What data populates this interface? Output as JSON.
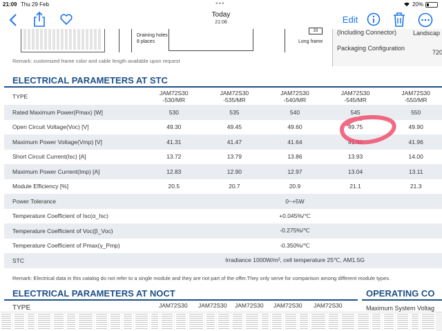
{
  "status_bar": {
    "time": "21:09",
    "date": "Thu 29 Feb",
    "battery": "20%"
  },
  "toolbar": {
    "title": "Today",
    "subtitle": "21:08",
    "edit_label": "Edit"
  },
  "drawing": {
    "drain_label_1": "Draining holes",
    "drain_label_2": "8 places",
    "dim_33": "33",
    "long_frame": "Long frame",
    "including_connector": "(Including Connector)",
    "landscape": "Landscap",
    "packaging": "Packaging Configuration",
    "packaging_value": "720"
  },
  "remark_frame": "Remark: customized frame color and cable length available upon request",
  "stc": {
    "title": "ELECTRICAL PARAMETERS AT STC",
    "type_label": "TYPE",
    "models": [
      [
        "JAM72S30",
        "-530/MR"
      ],
      [
        "JAM72S30",
        "-535/MR"
      ],
      [
        "JAM72S30",
        "-540/MR"
      ],
      [
        "JAM72S30",
        "-545/MR"
      ],
      [
        "JAM72S30",
        "-550/MR"
      ]
    ],
    "rows": [
      {
        "label": "Rated Maximum Power(Pmax) [W]",
        "values": [
          "530",
          "535",
          "540",
          "545",
          "550"
        ]
      },
      {
        "label": "Open Circuit Voltage(Voc) [V]",
        "values": [
          "49.30",
          "49.45",
          "49.60",
          "49.75",
          "49.90"
        ]
      },
      {
        "label": "Maximum Power Voltage(Vmp) [V]",
        "values": [
          "41.31",
          "41.47",
          "41.64",
          "41.80",
          "41.96"
        ]
      },
      {
        "label": "Short Circuit Current(Isc) [A]",
        "values": [
          "13.72",
          "13.79",
          "13.86",
          "13.93",
          "14.00"
        ]
      },
      {
        "label": "Maximum Power Current(Imp) [A]",
        "values": [
          "12.83",
          "12.90",
          "12.97",
          "13.04",
          "13.11"
        ]
      },
      {
        "label": "Module Efficiency [%]",
        "values": [
          "20.5",
          "20.7",
          "20.9",
          "21.1",
          "21.3"
        ]
      }
    ],
    "merged_rows": [
      {
        "label": "Power Tolerance",
        "value": "0~+5W"
      },
      {
        "label": "Temperature Coefficient of Isc(α_Isc)",
        "value": "+0.045%/℃"
      },
      {
        "label": "Temperature Coefficient of Voc(β_Voc)",
        "value": "-0.275%/℃"
      },
      {
        "label": "Temperature Coefficient of Pmax(γ_Pmp)",
        "value": "-0.350%/℃"
      },
      {
        "label": "STC",
        "value": "Irradiance 1000W/m²,  cell temperature 25℃, AM1.5G"
      }
    ]
  },
  "remark_data": "Remark: Electrical data in this catalog do not refer to a single module and they are not part of the offer.They only serve for comparison among different module types.",
  "noct": {
    "title": "ELECTRICAL PARAMETERS AT NOCT",
    "type_label": "TYPE",
    "models": [
      "JAM72S30",
      "JAM72S30",
      "JAM72S30",
      "JAM72S30",
      "JAM72S30"
    ]
  },
  "operating": {
    "title": "OPERATING CO",
    "max_system": "Maximum System Voltag"
  },
  "colors": {
    "accent": "#1a73e8",
    "heading": "#1d4f88",
    "annotation": "#f0506e",
    "row_shade": "#e9edf1"
  },
  "icons": [
    "back-icon",
    "share-icon",
    "heart-icon",
    "info-icon",
    "trash-icon",
    "more-icon",
    "wifi-icon",
    "battery-icon"
  ]
}
